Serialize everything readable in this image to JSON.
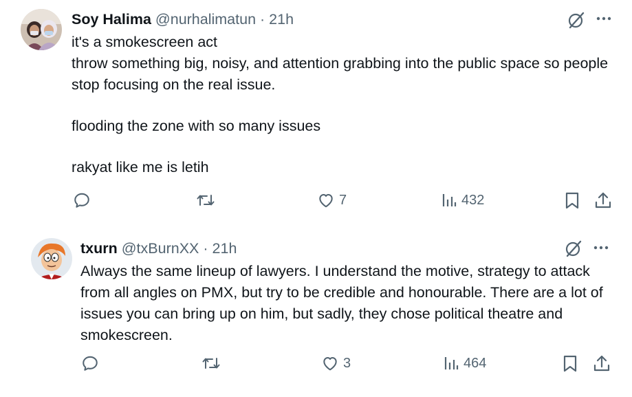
{
  "tweets": [
    {
      "name": "Soy Halima",
      "handle": "@nurhalimatun",
      "separator": "·",
      "time": "21h",
      "paragraphs": [
        "it's a smokescreen act\nthrow something big, noisy, and attention grabbing into the public space so people stop focusing on the real issue.",
        "flooding the zone with so many issues",
        "rakyat like me is letih"
      ],
      "actions": {
        "reply_icon": "reply-icon",
        "retweet_icon": "retweet-icon",
        "like_icon": "heart-icon",
        "like_count": "7",
        "views_icon": "views-icon",
        "views_count": "432",
        "bookmark_icon": "bookmark-icon",
        "share_icon": "share-icon"
      },
      "avatar": {
        "description_icon": "avatar-photo",
        "bg": "#c9b8a8"
      }
    },
    {
      "name": "txurn",
      "handle": "@txBurnXX",
      "separator": "·",
      "time": "21h",
      "paragraphs": [
        "Always the same lineup of lawyers. I understand the motive, strategy to attack from all angles on PMX, but try to be credible and honourable. There are a lot of issues you can bring up on him, but sadly, they chose political theatre and smokescreen."
      ],
      "actions": {
        "reply_icon": "reply-icon",
        "retweet_icon": "retweet-icon",
        "like_icon": "heart-icon",
        "like_count": "3",
        "views_icon": "views-icon",
        "views_count": "464",
        "bookmark_icon": "bookmark-icon",
        "share_icon": "share-icon"
      },
      "avatar": {
        "description_icon": "avatar-cartoon",
        "bg": "#dfe6ee"
      }
    }
  ],
  "colors": {
    "text_primary": "#0f1419",
    "text_secondary": "#536471",
    "background": "#ffffff"
  }
}
